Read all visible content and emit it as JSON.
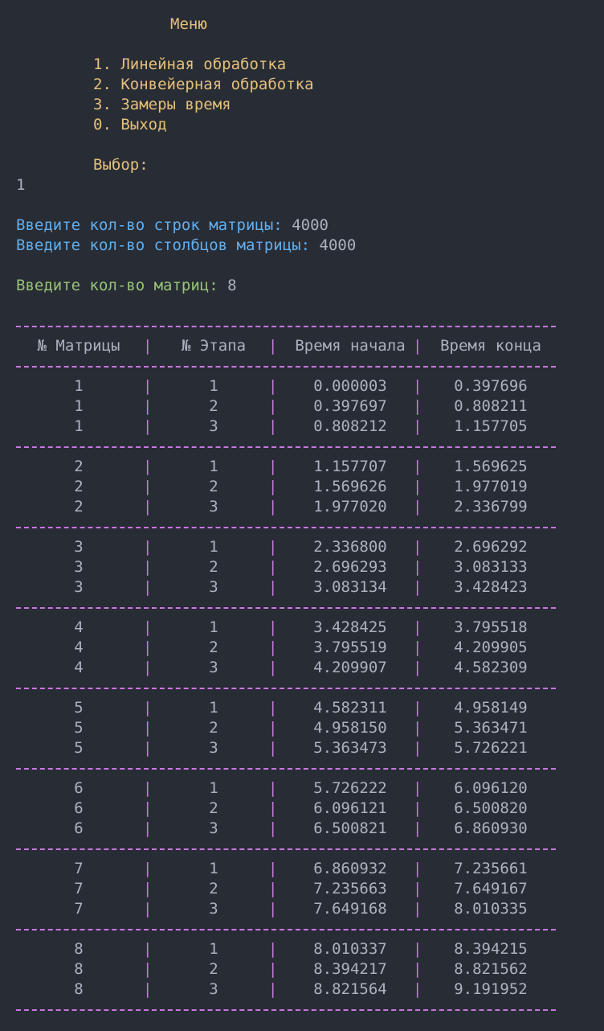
{
  "menu": {
    "title": "Меню",
    "items": [
      "1. Линейная обработка",
      "2. Конвейерная обработка",
      "3. Замеры время",
      "0. Выход"
    ],
    "choice_prompt": "Выбор:",
    "choice_value": "1"
  },
  "prompts": {
    "rows_label": "Введите кол-во строк матрицы:",
    "rows_value": "4000",
    "cols_label": "Введите кол-во столбцов матрицы:",
    "cols_value": "4000",
    "count_label": "Введите кол-во матриц:",
    "count_value": "8"
  },
  "table": {
    "headers": [
      "№ Матрицы",
      "№ Этапа",
      "Время начала",
      "Время конца"
    ],
    "groups": [
      [
        [
          "1",
          "1",
          "0.000003",
          "0.397696"
        ],
        [
          "1",
          "2",
          "0.397697",
          "0.808211"
        ],
        [
          "1",
          "3",
          "0.808212",
          "1.157705"
        ]
      ],
      [
        [
          "2",
          "1",
          "1.157707",
          "1.569625"
        ],
        [
          "2",
          "2",
          "1.569626",
          "1.977019"
        ],
        [
          "2",
          "3",
          "1.977020",
          "2.336799"
        ]
      ],
      [
        [
          "3",
          "1",
          "2.336800",
          "2.696292"
        ],
        [
          "3",
          "2",
          "2.696293",
          "3.083133"
        ],
        [
          "3",
          "3",
          "3.083134",
          "3.428423"
        ]
      ],
      [
        [
          "4",
          "1",
          "3.428425",
          "3.795518"
        ],
        [
          "4",
          "2",
          "3.795519",
          "4.209905"
        ],
        [
          "4",
          "3",
          "4.209907",
          "4.582309"
        ]
      ],
      [
        [
          "5",
          "1",
          "4.582311",
          "4.958149"
        ],
        [
          "5",
          "2",
          "4.958150",
          "5.363471"
        ],
        [
          "5",
          "3",
          "5.363473",
          "5.726221"
        ]
      ],
      [
        [
          "6",
          "1",
          "5.726222",
          "6.096120"
        ],
        [
          "6",
          "2",
          "6.096121",
          "6.500820"
        ],
        [
          "6",
          "3",
          "6.500821",
          "6.860930"
        ]
      ],
      [
        [
          "7",
          "1",
          "6.860932",
          "7.235661"
        ],
        [
          "7",
          "2",
          "7.235663",
          "7.649167"
        ],
        [
          "7",
          "3",
          "7.649168",
          "8.010335"
        ]
      ],
      [
        [
          "8",
          "1",
          "8.010337",
          "8.394215"
        ],
        [
          "8",
          "2",
          "8.394217",
          "8.821562"
        ],
        [
          "8",
          "3",
          "8.821564",
          "9.191952"
        ]
      ]
    ]
  },
  "colors": {
    "background": "#282c34",
    "menu_text": "#e5c07b",
    "prompt_blue": "#61afef",
    "prompt_green": "#98c379",
    "table_border": "#c678dd",
    "default_text": "#abb2bf"
  }
}
